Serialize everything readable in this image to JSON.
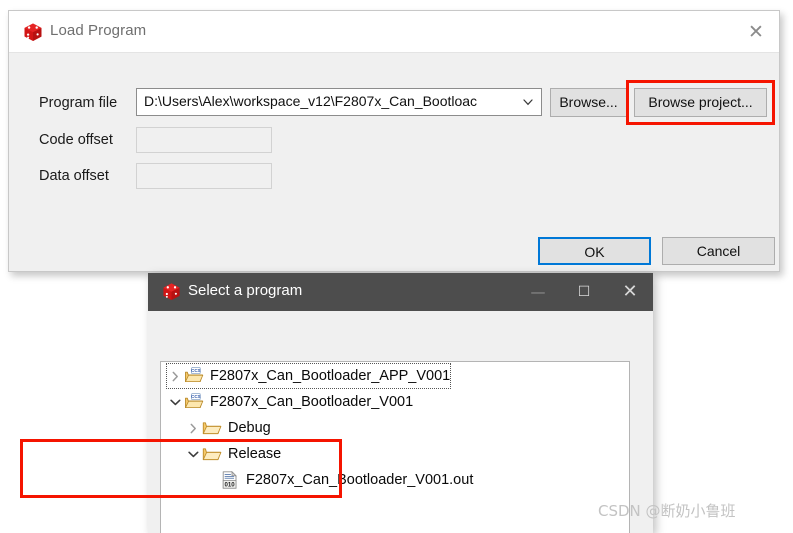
{
  "load_program_dialog": {
    "title": "Load Program",
    "title_icon": "red-cube-icon",
    "close_label": "✕",
    "fields": {
      "program_file_label": "Program file",
      "program_file_value": "D:\\Users\\Alex\\workspace_v12\\F2807x_Can_Bootloac",
      "code_offset_label": "Code offset",
      "code_offset_value": "",
      "data_offset_label": "Data offset",
      "data_offset_value": ""
    },
    "buttons": {
      "browse": "Browse...",
      "browse_project": "Browse project...",
      "ok": "OK",
      "cancel": "Cancel"
    },
    "highlight_color": "#f51400",
    "focus_color": "#0078d7"
  },
  "select_program_dialog": {
    "title": "Select a program",
    "title_icon": "red-cube-icon",
    "window_controls": {
      "minimize": "—",
      "maximize": "☐",
      "close": "✕"
    },
    "tree": [
      {
        "label": "F2807x_Can_Bootloader_APP_V001",
        "icon": "ccs-project-folder-icon",
        "arrow": "chevron-right-icon",
        "expanded": false,
        "depth": 0,
        "focused": true
      },
      {
        "label": "F2807x_Can_Bootloader_V001",
        "icon": "ccs-project-folder-icon",
        "arrow": "chevron-down-icon",
        "expanded": true,
        "depth": 0,
        "focused": false
      },
      {
        "label": "Debug",
        "icon": "folder-icon",
        "arrow": "chevron-right-icon",
        "expanded": false,
        "depth": 1,
        "focused": false
      },
      {
        "label": "Release",
        "icon": "folder-icon",
        "arrow": "chevron-down-icon",
        "expanded": true,
        "depth": 1,
        "focused": false
      },
      {
        "label": "F2807x_Can_Bootloader_V001.out",
        "icon": "binary-file-icon",
        "arrow": "none",
        "expanded": false,
        "depth": 2,
        "focused": false
      }
    ],
    "highlight_color": "#f51400"
  },
  "watermark": {
    "text": "CSDN @断奶小鲁班"
  }
}
